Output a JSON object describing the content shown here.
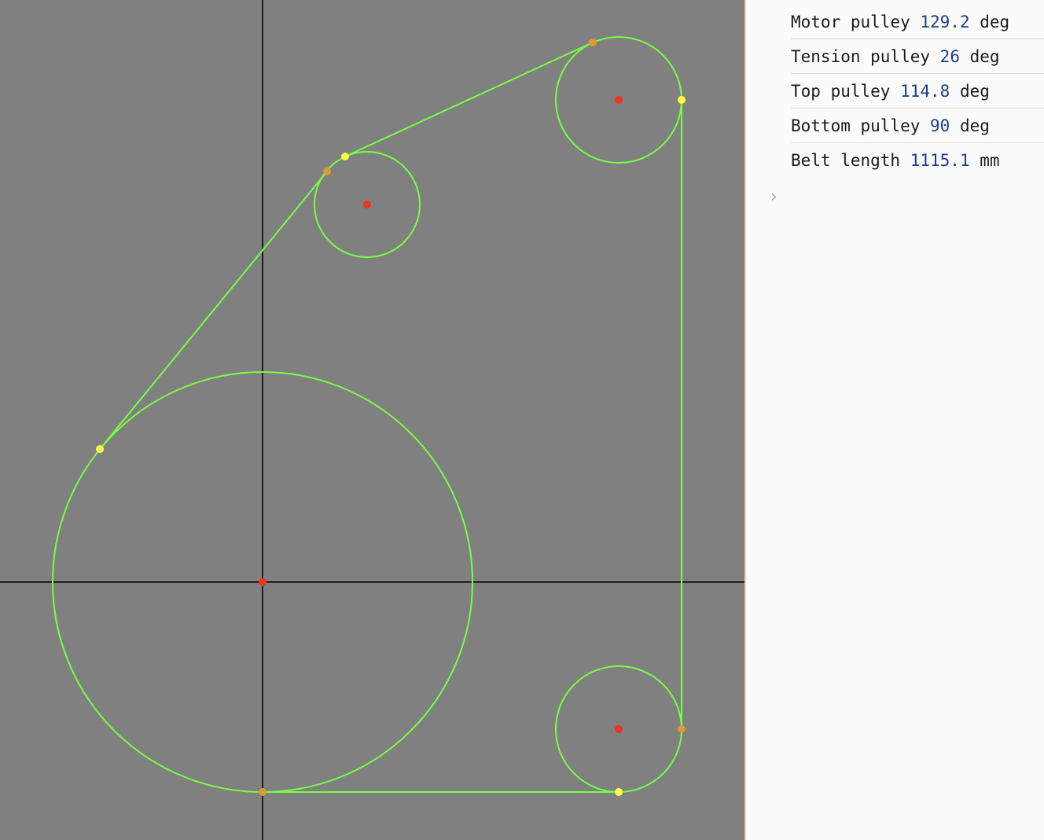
{
  "canvas": {
    "background": "#808080",
    "belt_color": "#77ff44",
    "center_color": "#ee3322",
    "tangent_start_color": "#ffff44",
    "tangent_end_color": "#dd9933",
    "axis_color": "#000000"
  },
  "readout": {
    "rows": [
      {
        "label": "Motor pulley",
        "value": "129.2",
        "unit": "deg"
      },
      {
        "label": "Tension pulley",
        "value": "26",
        "unit": "deg"
      },
      {
        "label": "Top pulley",
        "value": "114.8",
        "unit": "deg"
      },
      {
        "label": "Bottom pulley",
        "value": "90",
        "unit": "deg"
      },
      {
        "label": "Belt length",
        "value": "1115.1",
        "unit": "mm"
      }
    ],
    "prompt_symbol": "›",
    "value_color": "#1f3c88"
  }
}
